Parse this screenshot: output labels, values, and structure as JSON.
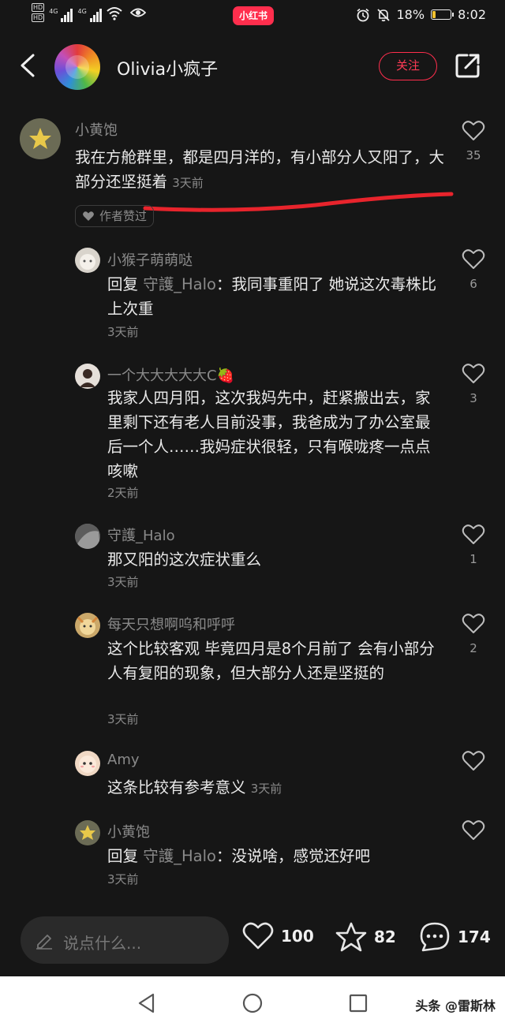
{
  "status_bar": {
    "hd1": "HD",
    "hd2": "HD",
    "net1": "4G",
    "net2": "4G",
    "app_badge": "小红书",
    "battery_percent": "18%",
    "battery_level": 0.18,
    "time": "8:02"
  },
  "header": {
    "author_name": "Olivia小疯子",
    "follow_label": "关注"
  },
  "comments": [
    {
      "name": "小黄饱",
      "text": "我在方舱群里，都是四月洋的，有小部分人又阳了，大部分还坚挺着",
      "time": "3天前",
      "likes": "35",
      "author_liked": "作者赞过"
    },
    {
      "name": "小猴子萌萌哒",
      "reply_prefix": "回复",
      "reply_target": "守護_Halo",
      "text": "：我同事重阳了 她说这次毒株比上次重",
      "time": "3天前",
      "likes": "6"
    },
    {
      "name": "一个大大大大大C🍓",
      "text": "我家人四月阳，这次我妈先中，赶紧搬出去，家里剩下还有老人目前没事，我爸成为了办公室最后一个人……我妈症状很轻，只有喉咙疼一点点咳嗽",
      "time": "2天前",
      "likes": "3"
    },
    {
      "name": "守護_Halo",
      "text": "那又阳的这次症状重么",
      "time": "3天前",
      "likes": "1"
    },
    {
      "name": "每天只想啊呜和呼呼",
      "text": "这个比较客观 毕竟四月是8个月前了 会有小部分人有复阳的现象，但大部分人还是坚挺的",
      "time": "3天前",
      "likes": "2"
    },
    {
      "name": "Amy",
      "text": "这条比较有参考意义",
      "time": "3天前",
      "likes": ""
    },
    {
      "name": "小黄饱",
      "reply_prefix": "回复",
      "reply_target": "守護_Halo",
      "text": "：没说啥，感觉还好吧",
      "time": "3天前",
      "likes": ""
    }
  ],
  "bottom": {
    "input_placeholder": "说点什么...",
    "likes": "100",
    "favorites": "82",
    "comments": "174"
  },
  "watermark": "头条 @雷斯林",
  "colors": {
    "brand": "#ff2e4d",
    "background": "#161616",
    "underline_mark": "#e8242c"
  }
}
